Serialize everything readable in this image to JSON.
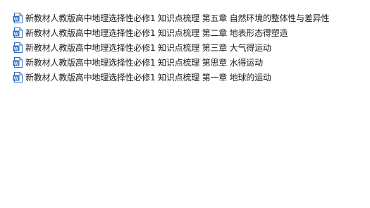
{
  "file_list": {
    "items": [
      {
        "icon": "word-doc-icon",
        "name": "新教材人教版高中地理选择性必修1 知识点梳理  第五章 自然环境的整体性与差异性"
      },
      {
        "icon": "word-doc-icon",
        "name": "新教材人教版高中地理选择性必修1 知识点梳理 第二章 地表形态得塑造"
      },
      {
        "icon": "word-doc-icon",
        "name": "新教材人教版高中地理选择性必修1 知识点梳理 第三章 大气得运动"
      },
      {
        "icon": "word-doc-icon",
        "name": "新教材人教版高中地理选择性必修1 知识点梳理 第思章 水得运动"
      },
      {
        "icon": "word-doc-icon",
        "name": "新教材人教版高中地理选择性必修1 知识点梳理 第一章 地球的运动"
      }
    ]
  },
  "colors": {
    "word_icon_blue": "#2b6cc4",
    "text": "#1b1b1b",
    "background": "#ffffff"
  }
}
